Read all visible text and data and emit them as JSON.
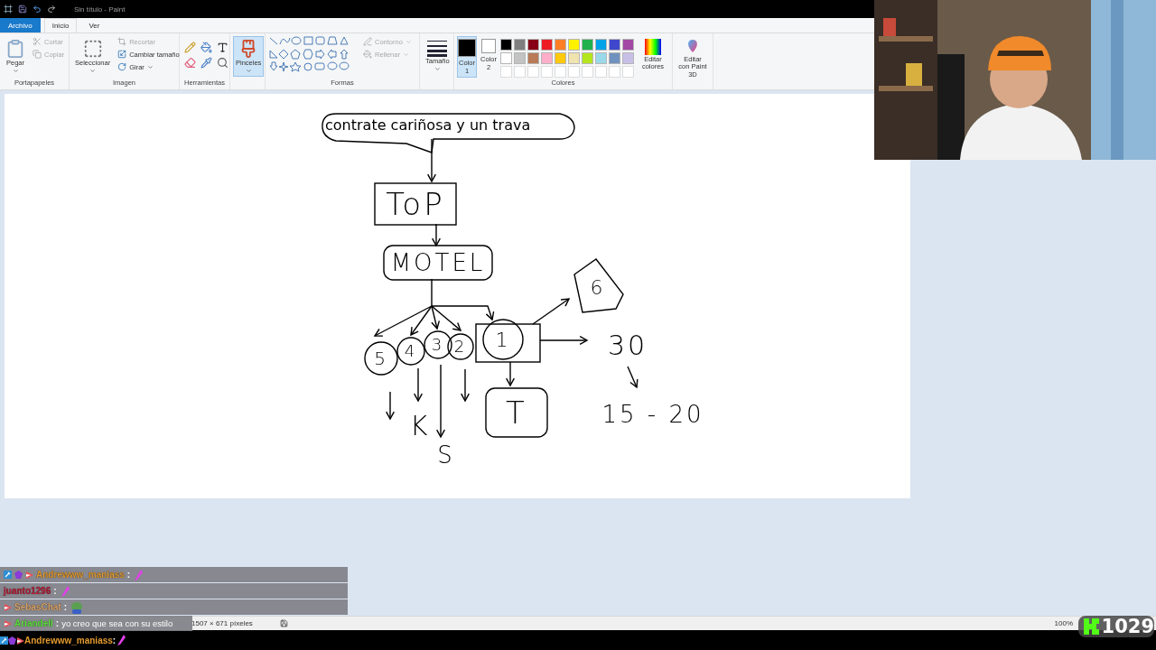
{
  "title_bar": {
    "title": "Sin título - Paint"
  },
  "menu_tabs": [
    {
      "label": "Archivo",
      "kind": "file",
      "selected": false
    },
    {
      "label": "Inicio",
      "kind": "tab",
      "selected": true
    },
    {
      "label": "Ver",
      "kind": "tab",
      "selected": false
    }
  ],
  "ribbon": {
    "clipboard": {
      "label": "Portapapeles",
      "paste": "Pegar",
      "cut": {
        "label": "Cortar",
        "disabled": true
      },
      "copy": {
        "label": "Copiar",
        "disabled": true
      }
    },
    "image": {
      "label": "Imagen",
      "select": "Seleccionar",
      "crop": {
        "label": "Recortar",
        "disabled": true
      },
      "resize": {
        "label": "Cambiar tamaño",
        "disabled": false
      },
      "rotate": {
        "label": "Girar",
        "disabled": false
      }
    },
    "tools": {
      "label": "Herramientas"
    },
    "brushes": {
      "label": "Pinceles",
      "selected": true
    },
    "shapes": {
      "label": "Formas",
      "outline": {
        "label": "Contorno",
        "disabled": true
      },
      "fill": {
        "label": "Rellenar",
        "disabled": true
      }
    },
    "size": {
      "label": "Tamaño"
    },
    "colors": {
      "label": "Colores",
      "color1": {
        "label": "Color 1",
        "color": "#000000",
        "selected": true
      },
      "color2": {
        "label": "Color 2",
        "color": "#ffffff",
        "selected": false
      },
      "palette": [
        {
          "color": "#000000"
        },
        {
          "color": "#7f7f7f"
        },
        {
          "color": "#880015"
        },
        {
          "color": "#ed1c24"
        },
        {
          "color": "#ff7f27"
        },
        {
          "color": "#fff200"
        },
        {
          "color": "#22b14c"
        },
        {
          "color": "#00a2e8"
        },
        {
          "color": "#3f48cc"
        },
        {
          "color": "#a349a4"
        },
        {
          "color": "#ffffff"
        },
        {
          "color": "#c3c3c3"
        },
        {
          "color": "#b97a57"
        },
        {
          "color": "#ffaec9"
        },
        {
          "color": "#ffc90e"
        },
        {
          "color": "#efe4b0"
        },
        {
          "color": "#b5e61d"
        },
        {
          "color": "#99d9ea"
        },
        {
          "color": "#7092be"
        },
        {
          "color": "#c8bfe7"
        }
      ],
      "edit": "Editar colores"
    },
    "paint3d": "Editar con Paint 3D"
  },
  "canvas": {
    "bubble_text": "contrate cariñosa y un trava",
    "labels": [
      {
        "text": "ToP",
        "kind": "box"
      },
      {
        "text": "MOTEL",
        "kind": "rounded"
      },
      {
        "text": "5",
        "kind": "circle"
      },
      {
        "text": "4",
        "kind": "circle"
      },
      {
        "text": "3",
        "kind": "circle"
      },
      {
        "text": "2",
        "kind": "circle"
      },
      {
        "text": "1",
        "kind": "circle"
      },
      {
        "text": "K",
        "kind": "plain"
      },
      {
        "text": "S",
        "kind": "plain"
      },
      {
        "text": "T",
        "kind": "rounded"
      },
      {
        "text": "6",
        "kind": "tilted"
      },
      {
        "text": "30",
        "kind": "plain"
      },
      {
        "text": "15 - 20",
        "kind": "plain"
      }
    ]
  },
  "status_bar": {
    "dimensions": "1507 × 671 píxeles",
    "zoom": "100%"
  },
  "chat": [
    {
      "user": "Andrewww_maniass",
      "sep": ":",
      "color": "#e39a2e",
      "badges": [
        {
          "kind": "tool"
        },
        {
          "kind": "gem"
        },
        {
          "kind": "flag"
        }
      ],
      "kind": "sparkle"
    },
    {
      "user": "juanto1296",
      "sep": ":",
      "color": "#b8213a",
      "kind": "sparkle"
    },
    {
      "user": "SebasChat",
      "sep": ":",
      "color": "#dca66a",
      "badges": [
        {
          "kind": "flag"
        }
      ],
      "kind": "frog"
    },
    {
      "user": "Ariandell",
      "sep": ":",
      "color": "#5ee23c",
      "badges": [
        {
          "kind": "flag"
        }
      ],
      "kind": "text",
      "text": "yo creo que sea con su estilo"
    }
  ],
  "chat_bar": {
    "user": "Andrewww_maniass",
    "sep": ":",
    "color": "#e39a2e",
    "badges": [
      {
        "kind": "tool"
      },
      {
        "kind": "gem"
      },
      {
        "kind": "flag"
      }
    ],
    "kind": "sparkle"
  },
  "counter": {
    "value": "1029"
  }
}
